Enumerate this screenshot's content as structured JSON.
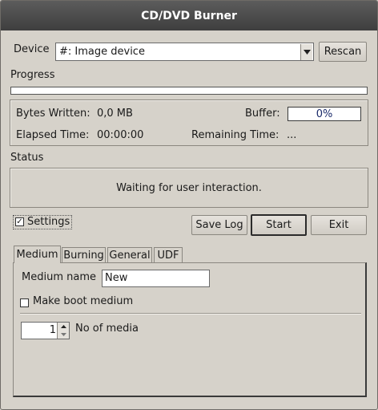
{
  "window": {
    "title": "CD/DVD Burner"
  },
  "device": {
    "label": "Device",
    "selected": "#: Image device",
    "rescan_label": "Rescan"
  },
  "progress": {
    "label": "Progress",
    "value": 0
  },
  "stats": {
    "bytes_written_label": "Bytes Written:",
    "bytes_written_value": "0,0 MB",
    "buffer_label": "Buffer:",
    "buffer_value": "0%",
    "elapsed_label": "Elapsed Time:",
    "elapsed_value": "00:00:00",
    "remaining_label": "Remaining Time:",
    "remaining_value": "..."
  },
  "status": {
    "label": "Status",
    "message": "Waiting for user interaction."
  },
  "settings": {
    "label": "Settings",
    "checked": true
  },
  "actions": {
    "save_log": "Save Log",
    "start": "Start",
    "exit": "Exit"
  },
  "tabs": [
    {
      "label": "Medium",
      "active": true
    },
    {
      "label": "Burning",
      "active": false
    },
    {
      "label": "General",
      "active": false
    },
    {
      "label": "UDF",
      "active": false
    }
  ],
  "medium": {
    "name_label": "Medium name",
    "name_value": "New",
    "boot_label": "Make boot medium",
    "boot_checked": false,
    "count_value": "1",
    "count_label": "No of media"
  }
}
